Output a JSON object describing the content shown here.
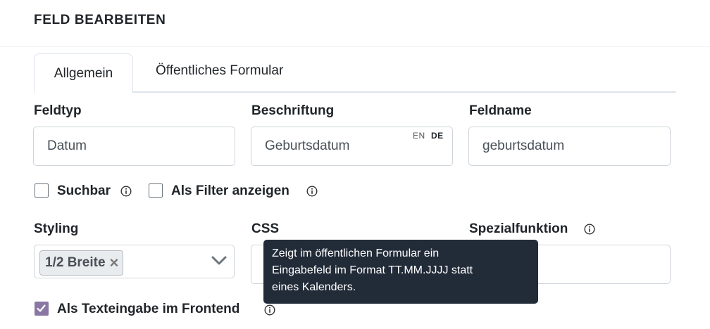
{
  "modal": {
    "title": "FELD BEARBEITEN"
  },
  "tabs": [
    {
      "label": "Allgemein",
      "active": true
    },
    {
      "label": "Öffentliches Formular",
      "active": false
    }
  ],
  "fields": {
    "feldtyp": {
      "label": "Feldtyp",
      "value": "Datum"
    },
    "beschriftung": {
      "label": "Beschriftung",
      "value": "Geburtsdatum",
      "lang_en": "EN",
      "lang_de": "DE"
    },
    "feldname": {
      "label": "Feldname",
      "value": "geburtsdatum"
    }
  },
  "checkboxes": {
    "suchbar": {
      "label": "Suchbar",
      "checked": false
    },
    "filter": {
      "label": "Als Filter anzeigen",
      "checked": false
    },
    "texteingabe": {
      "label": "Als Texteingabe im Frontend",
      "checked": true
    }
  },
  "styling": {
    "label": "Styling",
    "selected": "1/2 Breite",
    "remove": "×"
  },
  "css": {
    "label": "CSS",
    "value": ""
  },
  "spezialfunktion": {
    "label": "Spezialfunktion",
    "value": ""
  },
  "tooltip": {
    "text": "Zeigt im öffentlichen Formular ein\nEingabefeld im Format TT.MM.JJJJ statt\neines Kalenders."
  },
  "colors": {
    "checkbox_checked": "#8a77a3",
    "tooltip_bg": "#222b38"
  }
}
